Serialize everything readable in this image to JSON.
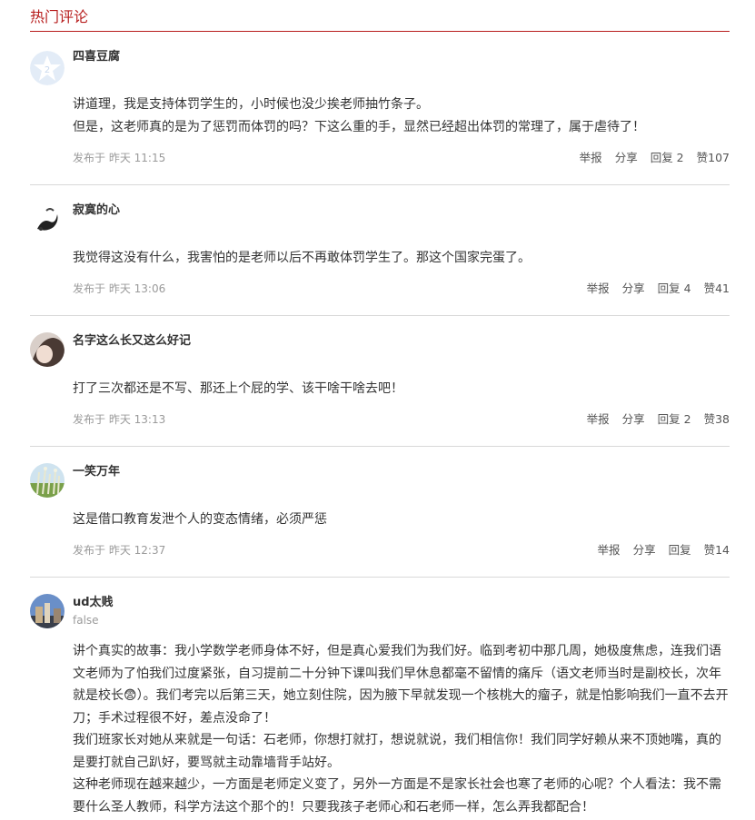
{
  "section": {
    "title": "热门评论"
  },
  "comments": [
    {
      "user": "四喜豆腐",
      "paras": [
        "讲道理，我是支持体罚学生的，小时候也没少挨老师抽竹条子。",
        "但是，这老师真的是为了惩罚而体罚的吗？下这么重的手，显然已经超出体罚的常理了，属于虐待了！"
      ],
      "time": "发布于 昨天 11:15",
      "report": "举报",
      "share": "分享",
      "reply": "回复 2",
      "like": "赞107"
    },
    {
      "user": "寂寞的心",
      "paras": [
        "我觉得这没有什么，我害怕的是老师以后不再敢体罚学生了。那这个国家完蛋了。"
      ],
      "time": "发布于 昨天 13:06",
      "report": "举报",
      "share": "分享",
      "reply": "回复 4",
      "like": "赞41"
    },
    {
      "user": "名字这么长又这么好记",
      "paras": [
        "打了三次都还是不写、那还上个屁的学、该干啥干啥去吧！"
      ],
      "time": "发布于 昨天 13:13",
      "report": "举报",
      "share": "分享",
      "reply": "回复 2",
      "like": "赞38"
    },
    {
      "user": "一笑万年",
      "paras": [
        "这是借口教育发泄个人的变态情绪，必须严惩"
      ],
      "time": "发布于 昨天 12:37",
      "report": "举报",
      "share": "分享",
      "reply": "回复",
      "like": "赞14"
    },
    {
      "user": "ud太贱",
      "sub": "false",
      "paras": [
        "讲个真实的故事：我小学数学老师身体不好，但是真心爱我们为我们好。临到考初中那几周，她极度焦虑，连我们语文老师为了怕我们过度紧张，自习提前二十分钟下课叫我们早休息都毫不留情的痛斥（语文老师当时是副校长，次年就是校长😨）。我们考完以后第三天，她立刻住院，因为腋下早就发现一个核桃大的瘤子，就是怕影响我们一直不去开刀；手术过程很不好，差点没命了！",
        "我们班家长对她从来就是一句话：石老师，你想打就打，想说就说，我们相信你！我们同学好赖从来不顶她嘴，真的是要打就自己趴好，要骂就主动靠墙背手站好。",
        "这种老师现在越来越少，一方面是老师定义变了，另外一方面是不是家长社会也寒了老师的心呢？个人看法：我不需要什么圣人教师，科学方法这个那个的！只要我孩子老师心和石老师一样，怎么弄我都配合！"
      ]
    }
  ]
}
